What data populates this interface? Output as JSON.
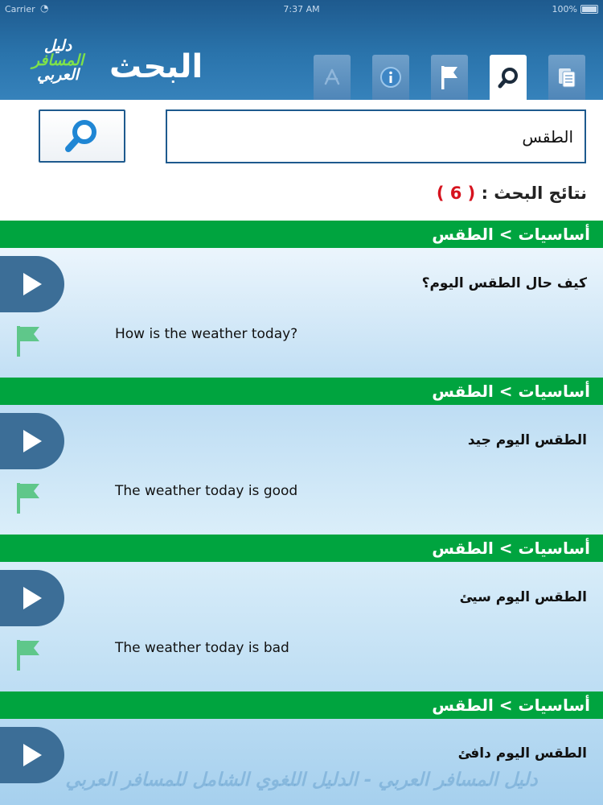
{
  "status_bar": {
    "carrier": "Carrier",
    "time": "7:37 AM",
    "battery": "100%"
  },
  "logo": {
    "line1": "دليل",
    "line2": "المسافر",
    "line3": "العربي"
  },
  "header": {
    "title": "البحث"
  },
  "tabs": [
    {
      "icon": "app-store-icon",
      "active": false
    },
    {
      "icon": "info-icon",
      "active": false
    },
    {
      "icon": "flag-icon",
      "active": false
    },
    {
      "icon": "search-icon",
      "active": true
    },
    {
      "icon": "pages-icon",
      "active": false
    }
  ],
  "search": {
    "value": "الطقس",
    "placeholder": ""
  },
  "results": {
    "label": "نتائج البحث :",
    "count": "( 6 )"
  },
  "items": [
    {
      "category": "أساسيات",
      "separator": ">",
      "subcategory": "الطقس",
      "arabic": "كيف حال الطقس اليوم؟",
      "english": "How is the weather today?"
    },
    {
      "category": "أساسيات",
      "separator": ">",
      "subcategory": "الطقس",
      "arabic": "الطقس اليوم جيد",
      "english": "The weather today is good"
    },
    {
      "category": "أساسيات",
      "separator": ">",
      "subcategory": "الطقس",
      "arabic": "الطقس اليوم سيئ",
      "english": "The weather today is bad"
    },
    {
      "category": "أساسيات",
      "separator": ">",
      "subcategory": "الطقس",
      "arabic": "الطقس اليوم دافئ",
      "english": ""
    }
  ],
  "footer": {
    "watermark": "دليل المسافر العربي - الدليل اللغوي الشامل للمسافر العربي"
  },
  "colors": {
    "header": "#2a74ac",
    "category_bar": "#00a43f",
    "play_button": "#3c6e97",
    "flag": "#5fc78a",
    "count": "#d6131e"
  }
}
